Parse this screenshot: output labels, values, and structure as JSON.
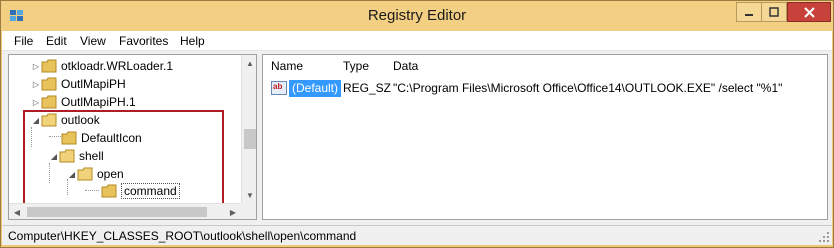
{
  "window": {
    "title": "Registry Editor",
    "accent_color": "#f3cf84",
    "icon": "registry-editor-icon"
  },
  "menu": {
    "items": [
      "File",
      "Edit",
      "View",
      "Favorites",
      "Help"
    ]
  },
  "tree": {
    "nodes": [
      {
        "label": "otkloadr.WRLoader.1",
        "expander": "collapsed"
      },
      {
        "label": "OutlMapiPH",
        "expander": "collapsed"
      },
      {
        "label": "OutlMapiPH.1",
        "expander": "collapsed"
      },
      {
        "label": "outlook",
        "expander": "expanded"
      },
      {
        "label": "DefaultIcon",
        "expander": "none"
      },
      {
        "label": "shell",
        "expander": "expanded"
      },
      {
        "label": "open",
        "expander": "expanded"
      },
      {
        "label": "command",
        "expander": "none",
        "selected": true
      }
    ],
    "highlight_color": "#b01c24"
  },
  "list": {
    "columns": [
      "Name",
      "Type",
      "Data"
    ],
    "rows": [
      {
        "name": "(Default)",
        "type": "REG_SZ",
        "data": "\"C:\\Program Files\\Microsoft Office\\Office14\\OUTLOOK.EXE\" /select \"%1\"",
        "icon_text": "ab"
      }
    ],
    "selection_color": "#3399ff"
  },
  "status": {
    "path": "Computer\\HKEY_CLASSES_ROOT\\outlook\\shell\\open\\command"
  }
}
